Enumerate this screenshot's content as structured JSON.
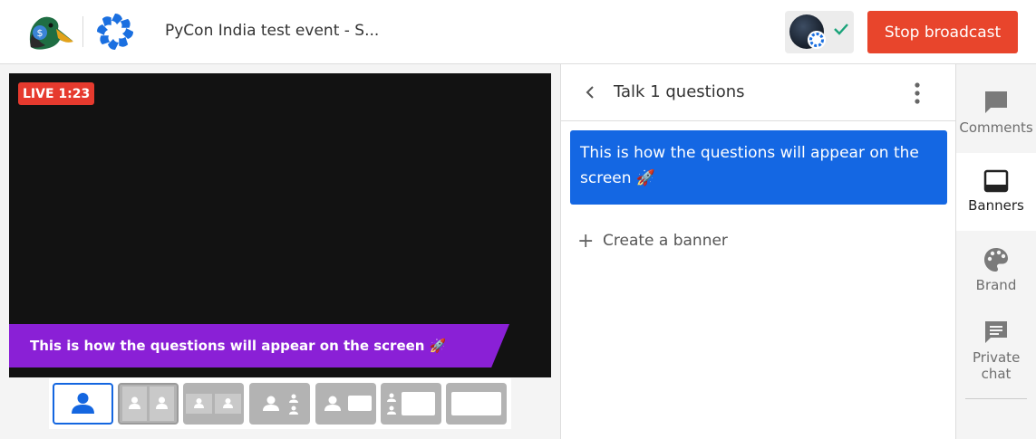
{
  "header": {
    "event_title": "PyCon India test event - S...",
    "stop_label": "Stop broadcast"
  },
  "stage": {
    "live_label": "LIVE 1:23",
    "banner_text": "This is how the questions will appear on the screen 🚀"
  },
  "layouts": [
    {
      "name": "solo"
    },
    {
      "name": "two-side-by-side"
    },
    {
      "name": "two-thin"
    },
    {
      "name": "group"
    },
    {
      "name": "person-and-screen"
    },
    {
      "name": "group-and-screen"
    },
    {
      "name": "screen-only"
    }
  ],
  "panel": {
    "title": "Talk 1 questions",
    "banner_card_text": "This is how the questions will appear on the screen 🚀",
    "create_label": "Create a banner"
  },
  "rail": {
    "comments": "Comments",
    "banners": "Banners",
    "brand": "Brand",
    "private_chat": "Private chat"
  },
  "colors": {
    "accent": "#1467e3",
    "stop": "#e8452c",
    "banner": "#8a20d6",
    "live": "#e63a2e"
  }
}
